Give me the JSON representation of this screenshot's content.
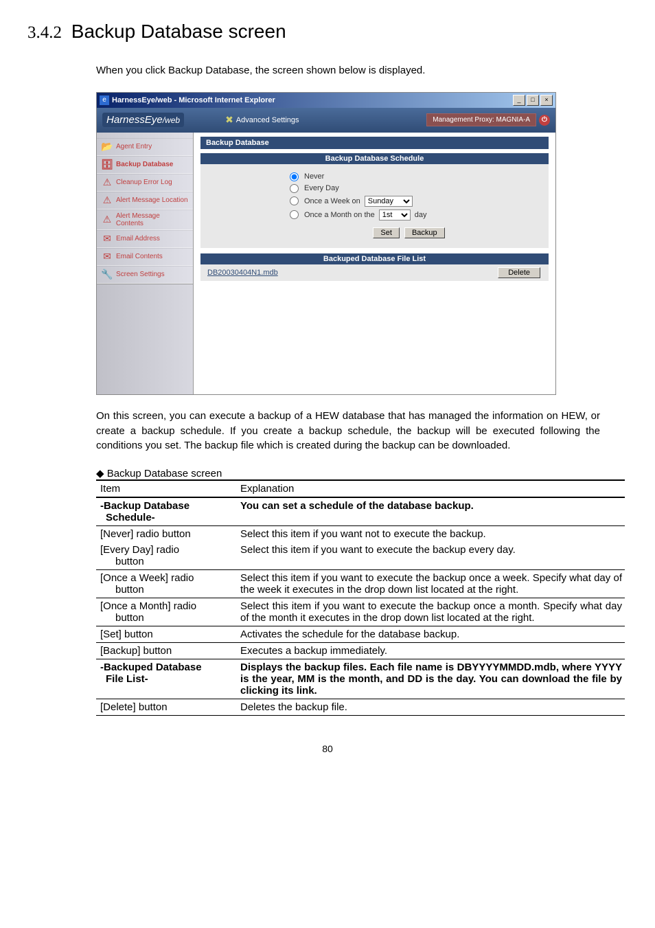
{
  "section": {
    "number": "3.4.2",
    "title": "Backup Database screen",
    "intro": "When you click Backup Database, the screen shown below is displayed.",
    "description": "On this screen, you can execute a backup of a HEW database that has managed the information on HEW, or create a backup schedule. If you create a backup schedule, the backup will be executed following the conditions you set. The backup file which is created during the backup can be downloaded.",
    "table_caption": "◆ Backup Database    screen"
  },
  "screenshot": {
    "window_title": "HarnessEye/web - Microsoft Internet Explorer",
    "logo_main": "HarnessEye",
    "logo_sub": "/web",
    "advanced_settings": "Advanced Settings",
    "mgmt_proxy": "Management Proxy: MAGNIA-A",
    "sidebar": [
      {
        "label": "Agent Entry",
        "icon": "📂"
      },
      {
        "label": "Backup Database",
        "icon": "🗄",
        "active": true
      },
      {
        "label": "Cleanup Error Log",
        "icon": "⚠"
      },
      {
        "label": "Alert Message Location",
        "icon": "⚠"
      },
      {
        "label": "Alert Message Contents",
        "icon": "⚠"
      },
      {
        "label": "Email Address",
        "icon": "✉"
      },
      {
        "label": "Email Contents",
        "icon": "✉"
      },
      {
        "label": "Screen Settings",
        "icon": "🔧"
      }
    ],
    "content_title": "Backup Database",
    "schedule_title": "Backup Database Schedule",
    "radio": {
      "never": "Never",
      "every_day": "Every Day",
      "once_week": "Once a Week on",
      "once_month_pre": "Once a Month on the",
      "once_month_suf": "day"
    },
    "week_value": "Sunday",
    "month_value": "1st",
    "btn_set": "Set",
    "btn_backup": "Backup",
    "filelist_title": "Backuped Database File List",
    "file_link": "DB20030404N1.mdb",
    "btn_delete": "Delete"
  },
  "table": {
    "header_item": "Item",
    "header_expl": "Explanation",
    "rows": [
      {
        "item": "-Backup Database Schedule-",
        "expl": "You can set a schedule of the database backup.",
        "bold": true
      },
      {
        "item": "[Never] radio button",
        "expl": "Select this item if you want not to execute the backup."
      },
      {
        "item": "[Every Day] radio button",
        "expl": "Select this item if you want to execute the backup every day."
      },
      {
        "item": "[Once a Week] radio button",
        "expl": "Select this item if you want to execute the backup once a week. Specify what day of the week it executes in the drop down list located at the right."
      },
      {
        "item": "[Once a Month] radio button",
        "expl": "Select this item if you want to execute the backup once a month. Specify what day of the month it executes in the drop down list located at the right."
      },
      {
        "item": "[Set] button",
        "expl": "Activates the schedule for the database backup."
      },
      {
        "item": "[Backup] button",
        "expl": "Executes a backup immediately."
      },
      {
        "item": "-Backuped Database File List-",
        "expl": "Displays the backup files. Each file name is DBYYYYMMDD.mdb, where YYYY is the year, MM is the month, and DD is the day. You can download the file by clicking its link.",
        "bold": true
      },
      {
        "item": "[Delete] button",
        "expl": "Deletes the backup file."
      }
    ]
  },
  "page_number": "80"
}
